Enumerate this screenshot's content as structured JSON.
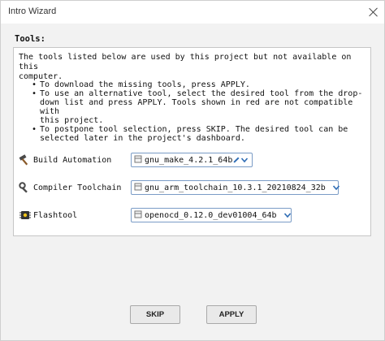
{
  "window": {
    "title": "Intro Wizard"
  },
  "section": {
    "heading": "Tools:"
  },
  "panel": {
    "intro_line1": "The tools listed below are used by this project but not available on this",
    "intro_line2": "computer.",
    "bullets": [
      [
        "To download the missing tools, press APPLY."
      ],
      [
        "To use an alternative tool, select the desired tool from the drop-",
        "down list and press APPLY. Tools shown in red are not compatible with",
        "this project."
      ],
      [
        "To postpone tool selection, press SKIP. The desired tool can be",
        "selected later in the project's dashboard."
      ]
    ],
    "tools": [
      {
        "label": "Build Automation",
        "value": "gnu_make_4.2.1_64b",
        "icon": "hammer-icon"
      },
      {
        "label": "Compiler Toolchain",
        "value": "gnu_arm_toolchain_10.3.1_20210824_32b",
        "icon": "wrench-icon"
      },
      {
        "label": "Flashtool",
        "value": "openocd_0.12.0_dev01004_64b",
        "icon": "chip-icon"
      }
    ]
  },
  "buttons": {
    "skip": "SKIP",
    "apply": "APPLY"
  },
  "colors": {
    "combo_border": "#7a9cc6",
    "gem": "#2f6db5"
  }
}
